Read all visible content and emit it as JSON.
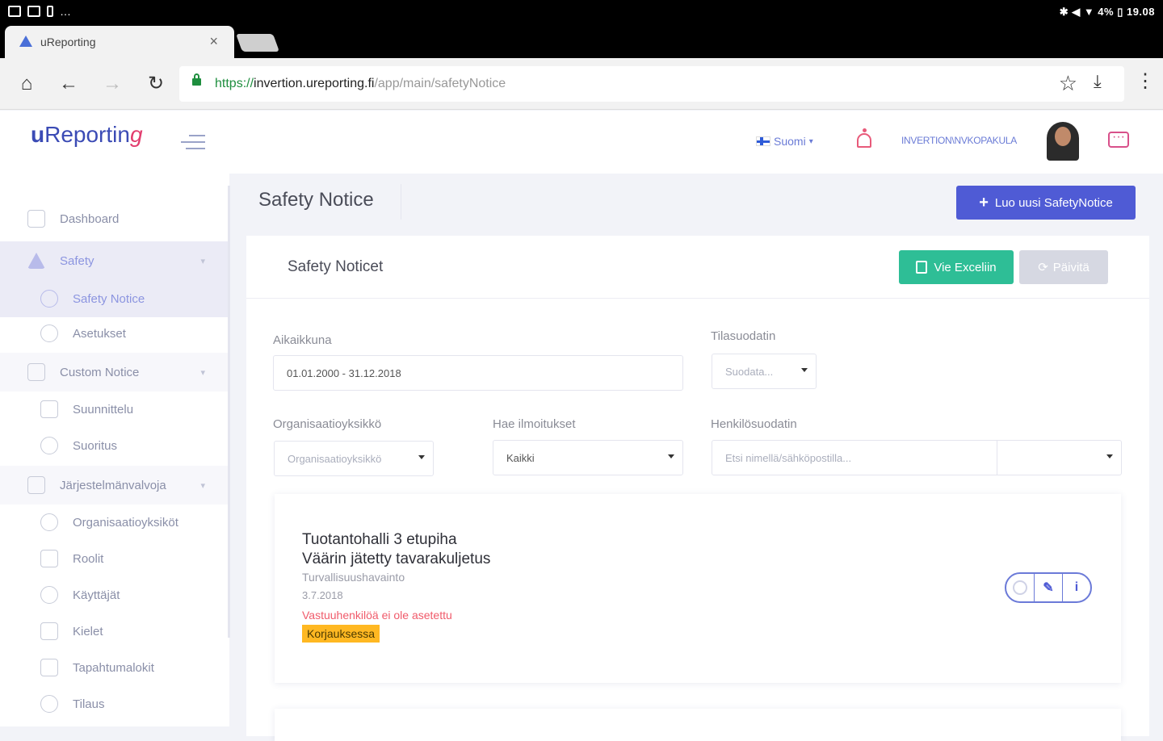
{
  "statusbar": {
    "right_text": "✱ ◀ ▼ 4% ▯ 19.08"
  },
  "browser": {
    "tab_title": "uReporting",
    "tab_close": "×",
    "url_scheme": "https://",
    "url_host": "invertion.ureporting.fi",
    "url_path": "/app/main/safetyNotice"
  },
  "header": {
    "logo_u": "u",
    "logo_rest": "Reportin",
    "logo_g": "g",
    "language": "Suomi",
    "username": "INVERTION\\NVKOPAKULA"
  },
  "sidebar": {
    "items": [
      {
        "label": "Dashboard"
      },
      {
        "label": "Safety"
      },
      {
        "label": "Safety Notice"
      },
      {
        "label": "Asetukset"
      },
      {
        "label": "Custom Notice"
      },
      {
        "label": "Suunnittelu"
      },
      {
        "label": "Suoritus"
      },
      {
        "label": "Järjestelmänvalvoja"
      },
      {
        "label": "Organisaatioyksiköt"
      },
      {
        "label": "Roolit"
      },
      {
        "label": "Käyttäjät"
      },
      {
        "label": "Kielet"
      },
      {
        "label": "Tapahtumalokit"
      },
      {
        "label": "Tilaus"
      }
    ]
  },
  "main": {
    "page_title": "Safety Notice",
    "new_button": "Luo uusi SafetyNotice",
    "card_title": "Safety Noticet",
    "excel_button": "Vie Exceliin",
    "refresh_button": "Päivitä",
    "filters": {
      "time_label": "Aikaikkuna",
      "time_value": "01.01.2000 - 31.12.2018",
      "status_label": "Tilasuodatin",
      "status_placeholder": "Suodata...",
      "org_label": "Organisaatioyksikkö",
      "org_placeholder": "Organisaatioyksikkö",
      "search_label": "Hae ilmoitukset",
      "search_value": "Kaikki",
      "person_label": "Henkilösuodatin",
      "person_placeholder": "Etsi nimellä/sähköpostilla..."
    },
    "notice": {
      "line1": "Tuotantohalli 3 etupiha",
      "line2": "Väärin jätetty tavarakuljetus",
      "type": "Turvallisuushavainto",
      "date": "3.7.2018",
      "warning": "Vastuuhenkilöä ei ole asetettu",
      "status": "Korjauksessa"
    }
  }
}
